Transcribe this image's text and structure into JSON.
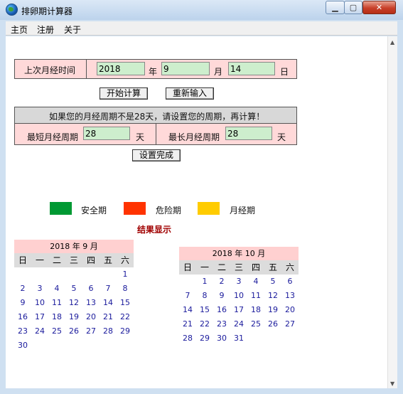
{
  "window": {
    "title": "排卵期计算器"
  },
  "menu": [
    "主页",
    "注册",
    "关于"
  ],
  "last_period": {
    "label": "上次月经时间",
    "year": "2018",
    "year_unit": "年",
    "month": "9",
    "month_unit": "月",
    "day": "14",
    "day_unit": "日"
  },
  "buttons": {
    "start": "开始计算",
    "reset": "重新输入",
    "done": "设置完成"
  },
  "cycle": {
    "notice": "如果您的月经周期不是28天，请设置您的周期，再计算！",
    "min_label": "最短月经周期",
    "min_value": "28",
    "min_unit": "天",
    "max_label": "最长月经周期",
    "max_value": "28",
    "max_unit": "天"
  },
  "legend": [
    {
      "label": "安全期",
      "color": "#009933"
    },
    {
      "label": "危险期",
      "color": "#ff3300"
    },
    {
      "label": "月经期",
      "color": "#ffcc00"
    }
  ],
  "result_title": "结果显示",
  "weekdays": [
    "日",
    "一",
    "二",
    "三",
    "四",
    "五",
    "六"
  ],
  "calendars": [
    {
      "title": "2018 年 9 月",
      "weeks": [
        [
          "",
          "",
          "",
          "",
          "",
          "",
          "1"
        ],
        [
          "2",
          "3",
          "4",
          "5",
          "6",
          "7",
          "8"
        ],
        [
          "9",
          "10",
          "11",
          "12",
          "13",
          "14",
          "15"
        ],
        [
          "16",
          "17",
          "18",
          "19",
          "20",
          "21",
          "22"
        ],
        [
          "23",
          "24",
          "25",
          "26",
          "27",
          "28",
          "29"
        ],
        [
          "30",
          "",
          "",
          "",
          "",
          "",
          ""
        ]
      ]
    },
    {
      "title": "2018 年 10 月",
      "weeks": [
        [
          "",
          "1",
          "2",
          "3",
          "4",
          "5",
          "6"
        ],
        [
          "7",
          "8",
          "9",
          "10",
          "11",
          "12",
          "13"
        ],
        [
          "14",
          "15",
          "16",
          "17",
          "18",
          "19",
          "20"
        ],
        [
          "21",
          "22",
          "23",
          "24",
          "25",
          "26",
          "27"
        ],
        [
          "28",
          "29",
          "30",
          "31",
          "",
          "",
          ""
        ]
      ]
    }
  ]
}
